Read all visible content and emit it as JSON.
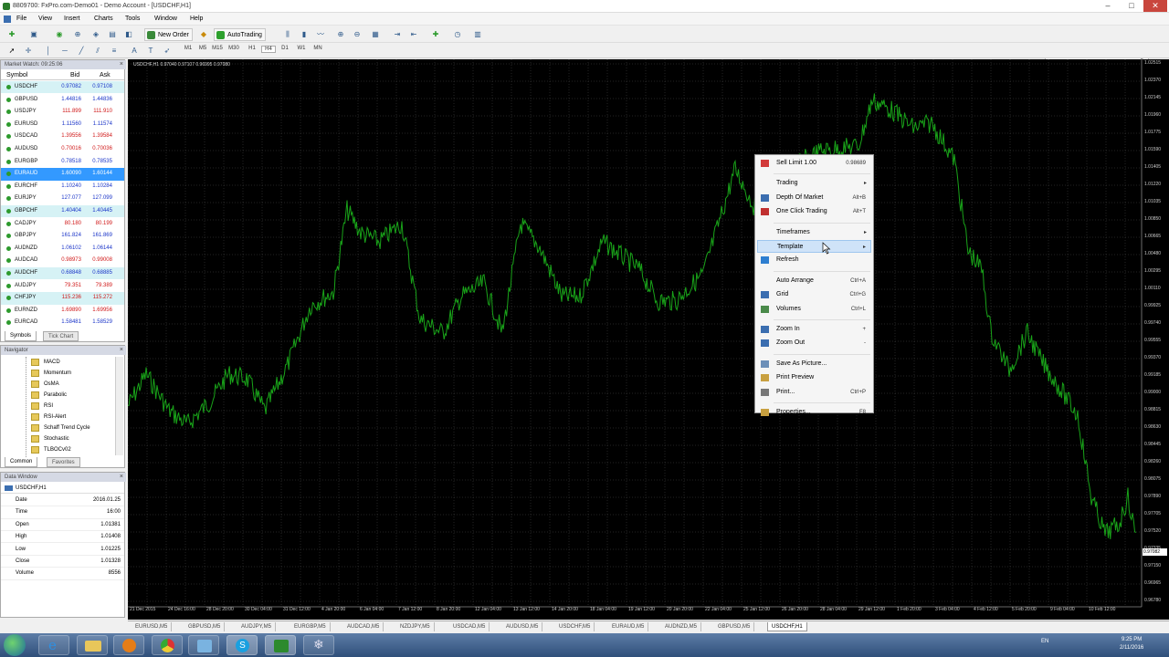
{
  "window": {
    "title": "8809700: FxPro.com-Demo01 - Demo Account - [USDCHF,H1]",
    "min": "–",
    "max": "□",
    "close": "✕"
  },
  "menu": [
    "File",
    "View",
    "Insert",
    "Charts",
    "Tools",
    "Window",
    "Help"
  ],
  "toolbar": {
    "new_order": "New Order",
    "autotrading": "AutoTrading",
    "timeframes": [
      "M1",
      "M5",
      "M15",
      "M30",
      "H1",
      "H4",
      "D1",
      "W1",
      "MN"
    ]
  },
  "market_watch": {
    "header": "Market Watch: 09:25:06",
    "columns": [
      "Symbol",
      "Bid",
      "Ask"
    ],
    "rows": [
      {
        "symbol": "USDCHF",
        "bid": "0.97082",
        "ask": "0.97108",
        "dir": "up",
        "bg": "cyan"
      },
      {
        "symbol": "GBPUSD",
        "bid": "1.44816",
        "ask": "1.44836",
        "dir": "up",
        "bg": ""
      },
      {
        "symbol": "USDJPY",
        "bid": "111.899",
        "ask": "111.910",
        "dir": "dn",
        "bg": ""
      },
      {
        "symbol": "EURUSD",
        "bid": "1.11560",
        "ask": "1.11574",
        "dir": "up",
        "bg": ""
      },
      {
        "symbol": "USDCAD",
        "bid": "1.39556",
        "ask": "1.39584",
        "dir": "dn",
        "bg": ""
      },
      {
        "symbol": "AUDUSD",
        "bid": "0.70016",
        "ask": "0.70036",
        "dir": "dn",
        "bg": ""
      },
      {
        "symbol": "EURGBP",
        "bid": "0.78518",
        "ask": "0.78535",
        "dir": "up",
        "bg": ""
      },
      {
        "symbol": "EURAUD",
        "bid": "1.60090",
        "ask": "1.60144",
        "dir": "up",
        "bg": "sel"
      },
      {
        "symbol": "EURCHF",
        "bid": "1.10240",
        "ask": "1.10284",
        "dir": "up",
        "bg": ""
      },
      {
        "symbol": "EURJPY",
        "bid": "127.077",
        "ask": "127.099",
        "dir": "up",
        "bg": ""
      },
      {
        "symbol": "GBPCHF",
        "bid": "1.40404",
        "ask": "1.40445",
        "dir": "up",
        "bg": "cyan"
      },
      {
        "symbol": "CADJPY",
        "bid": "80.180",
        "ask": "80.199",
        "dir": "dn",
        "bg": ""
      },
      {
        "symbol": "GBPJPY",
        "bid": "161.824",
        "ask": "161.869",
        "dir": "up",
        "bg": ""
      },
      {
        "symbol": "AUDNZD",
        "bid": "1.06102",
        "ask": "1.06144",
        "dir": "up",
        "bg": ""
      },
      {
        "symbol": "AUDCAD",
        "bid": "0.98973",
        "ask": "0.99008",
        "dir": "dn",
        "bg": ""
      },
      {
        "symbol": "AUDCHF",
        "bid": "0.68848",
        "ask": "0.68885",
        "dir": "up",
        "bg": "cyan"
      },
      {
        "symbol": "AUDJPY",
        "bid": "79.351",
        "ask": "79.389",
        "dir": "dn",
        "bg": ""
      },
      {
        "symbol": "CHFJPY",
        "bid": "115.236",
        "ask": "115.272",
        "dir": "dn",
        "bg": "cyan"
      },
      {
        "symbol": "EURNZD",
        "bid": "1.69890",
        "ask": "1.69956",
        "dir": "dn",
        "bg": ""
      },
      {
        "symbol": "EURCAD",
        "bid": "1.58481",
        "ask": "1.58529",
        "dir": "up",
        "bg": ""
      }
    ],
    "tabs": [
      "Symbols",
      "Tick Chart"
    ]
  },
  "navigator": {
    "header": "Navigator",
    "items": [
      "MACD",
      "Momentum",
      "OsMA",
      "Parabolic",
      "RSI",
      "RSI-Alert",
      "Schaff Trend Cycle",
      "Stochastic",
      "TLBOCv02"
    ],
    "tabs": [
      "Common",
      "Favorites"
    ]
  },
  "data_window": {
    "header": "Data Window",
    "symbol": "USDCHF,H1",
    "rows": [
      {
        "k": "Date",
        "v": "2016.01.25"
      },
      {
        "k": "Time",
        "v": "16:00"
      },
      {
        "k": "Open",
        "v": "1.01381"
      },
      {
        "k": "High",
        "v": "1.01408"
      },
      {
        "k": "Low",
        "v": "1.01225"
      },
      {
        "k": "Close",
        "v": "1.01328"
      },
      {
        "k": "Volume",
        "v": "8556"
      }
    ]
  },
  "chart": {
    "info": "USDCHF,H1  0.97040  0.97107  0.96995  0.97080",
    "current_price": "0.97082",
    "y_labels": [
      "1.02515",
      "1.02370",
      "1.02145",
      "1.01960",
      "1.01775",
      "1.01590",
      "1.01405",
      "1.01220",
      "1.01035",
      "1.00850",
      "1.00665",
      "1.00480",
      "1.00295",
      "1.00110",
      "0.99925",
      "0.99740",
      "0.99555",
      "0.99370",
      "0.99185",
      "0.99000",
      "0.98815",
      "0.98630",
      "0.98445",
      "0.98260",
      "0.98075",
      "0.97890",
      "0.97705",
      "0.97520",
      "0.97335",
      "0.97150",
      "0.96965",
      "0.96780"
    ],
    "x_labels": [
      "21 Dec 2015",
      "24 Dec 16:00",
      "28 Dec 20:00",
      "30 Dec 04:00",
      "31 Dec 12:00",
      "4 Jan 20:00",
      "6 Jan 04:00",
      "7 Jan 12:00",
      "8 Jan 20:00",
      "12 Jan 04:00",
      "13 Jan 12:00",
      "14 Jan 20:00",
      "18 Jan 04:00",
      "19 Jan 12:00",
      "20 Jan 20:00",
      "22 Jan 04:00",
      "25 Jan 12:00",
      "26 Jan 20:00",
      "28 Jan 04:00",
      "29 Jan 12:00",
      "1 Feb 20:00",
      "3 Feb 04:00",
      "4 Feb 12:00",
      "5 Feb 20:00",
      "9 Feb 04:00",
      "10 Feb 12:00"
    ],
    "line_color": "#19a319",
    "bg_color": "#000000"
  },
  "chart_tabs": [
    "EURUSD,M5",
    "GBPUSD,M5",
    "AUDJPY,M5",
    "EURGBP,M5",
    "AUDCAD,M5",
    "NZDJPY,M5",
    "USDCAD,M5",
    "AUDUSD,M5",
    "USDCHF,M5",
    "EURAUD,M5",
    "AUDNZD,M5",
    "GBPUSD,M5",
    "USDCHF,H1"
  ],
  "active_chart_tab": "USDCHF,H1",
  "context_menu": {
    "items": [
      {
        "label": "Sell Limit 1.00",
        "shortcut": "0.98689",
        "icon": "sell-limit-icon"
      },
      {
        "sep": true
      },
      {
        "label": "Trading",
        "arrow": "▸"
      },
      {
        "label": "Depth Of Market",
        "shortcut": "Alt+B",
        "icon": "depth-icon"
      },
      {
        "label": "One Click Trading",
        "shortcut": "Alt+T",
        "icon": "one-click-icon"
      },
      {
        "sep": true
      },
      {
        "label": "Timeframes",
        "arrow": "▸"
      },
      {
        "label": "Template",
        "arrow": "▸",
        "hl": true
      },
      {
        "label": "Refresh",
        "icon": "refresh-icon"
      },
      {
        "sep": true
      },
      {
        "label": "Auto Arrange",
        "shortcut": "Ctrl+A"
      },
      {
        "label": "Grid",
        "shortcut": "Ctrl+G",
        "icon": "grid-icon"
      },
      {
        "label": "Volumes",
        "shortcut": "Ctrl+L",
        "icon": "volumes-icon"
      },
      {
        "sep": true
      },
      {
        "label": "Zoom In",
        "shortcut": "+",
        "icon": "zoom-in-icon"
      },
      {
        "label": "Zoom Out",
        "shortcut": "-",
        "icon": "zoom-out-icon"
      },
      {
        "sep": true
      },
      {
        "label": "Save As Picture...",
        "icon": "save-picture-icon"
      },
      {
        "label": "Print Preview",
        "icon": "print-preview-icon"
      },
      {
        "label": "Print...",
        "shortcut": "Ctrl+P",
        "icon": "print-icon"
      },
      {
        "sep": true
      },
      {
        "label": "Properties...",
        "shortcut": "F8",
        "icon": "properties-icon"
      }
    ]
  },
  "taskbar": {
    "lang": "EN",
    "time": "9:25 PM",
    "date": "2/11/2016"
  }
}
